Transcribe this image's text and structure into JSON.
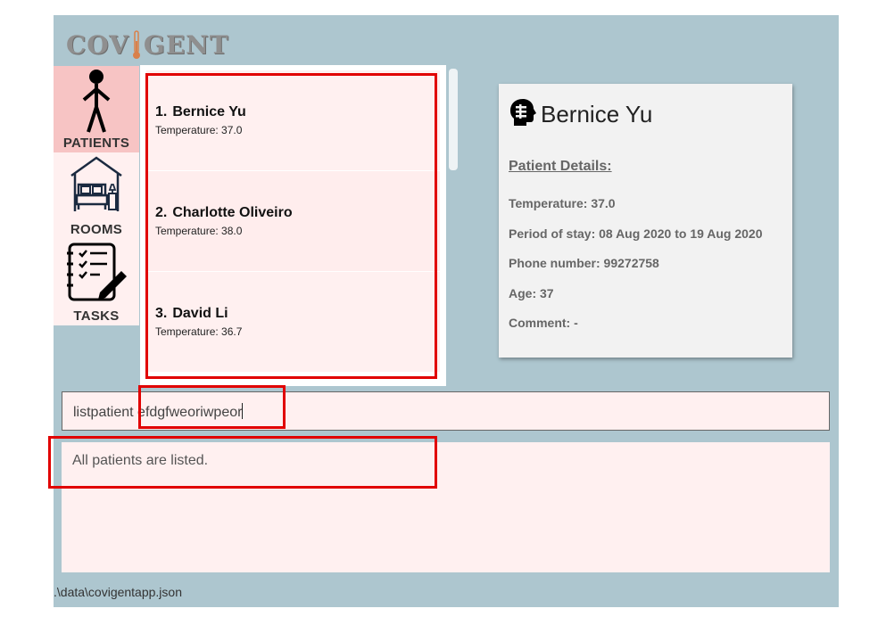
{
  "app": {
    "logo_text_left": "COV",
    "logo_text_right": "GENT",
    "accent": "#adc6cf"
  },
  "sidebar": {
    "items": [
      {
        "label": "PATIENTS",
        "icon": "person-icon"
      },
      {
        "label": "ROOMS",
        "icon": "bed-icon"
      },
      {
        "label": "TASKS",
        "icon": "checklist-icon"
      }
    ]
  },
  "patients": [
    {
      "index": "1.",
      "name": "Bernice Yu",
      "temperature": "Temperature: 37.0"
    },
    {
      "index": "2.",
      "name": "Charlotte Oliveiro",
      "temperature": "Temperature: 38.0"
    },
    {
      "index": "3.",
      "name": "David Li",
      "temperature": "Temperature: 36.7"
    }
  ],
  "detail": {
    "name": "Bernice Yu",
    "heading": "Patient Details:",
    "temperature": "Temperature: 37.0",
    "period": "Period of stay: 08 Aug 2020 to 19 Aug 2020",
    "phone": "Phone number: 99272758",
    "age": "Age: 37",
    "comment": "Comment: -"
  },
  "command": {
    "value": "listpatient efdgfweoriwpeor"
  },
  "result": {
    "text": "All patients are listed."
  },
  "status": {
    "path": ".\\data\\covigentapp.json"
  },
  "highlight_color": "#e10000"
}
